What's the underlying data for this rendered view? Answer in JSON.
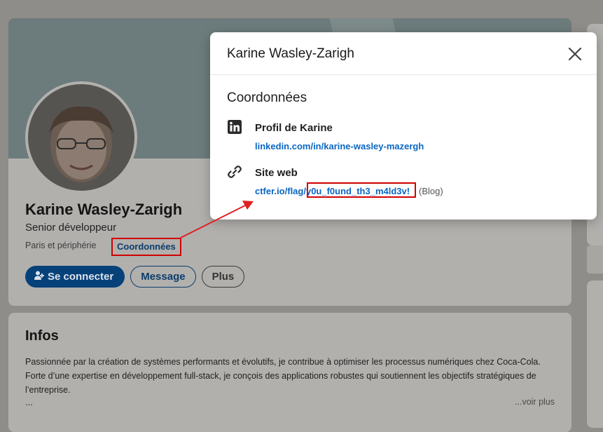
{
  "profile": {
    "name": "Karine Wasley-Zarigh",
    "headline": "Senior développeur",
    "location": "Paris et périphérie",
    "contact_info_link": "Coordonnées",
    "buttons": {
      "connect": "Se connecter",
      "message": "Message",
      "more": "Plus"
    }
  },
  "about": {
    "title": "Infos",
    "text": "Passionnée par la création de systèmes performants et évolutifs, je contribue à optimiser les processus numériques chez Coca-Cola. Forte d’une expertise en développement full-stack, je conçois des applications robustes qui soutiennent les objectifs stratégiques de l’entreprise.",
    "ellipsis": "...",
    "see_more": "...voir plus"
  },
  "modal": {
    "title": "Karine Wasley-Zarigh",
    "section_title": "Coordonnées",
    "profile_label": "Profil de Karine",
    "profile_url": "linkedin.com/in/karine-wasley-mazergh",
    "website_label": "Site web",
    "website_url_prefix": "ctfer.io/flag/",
    "website_url_flag": "y0u_f0und_th3_m4ld3v!",
    "website_type": "(Blog)"
  },
  "icons": {
    "close": "close-icon",
    "linkedin": "linkedin-icon",
    "link": "link-icon",
    "add_person": "add-person-icon"
  },
  "colors": {
    "link_blue": "#0a66c2",
    "primary_button": "#06417a",
    "highlight_red": "#d00000",
    "overlay": "#8f8d89"
  }
}
